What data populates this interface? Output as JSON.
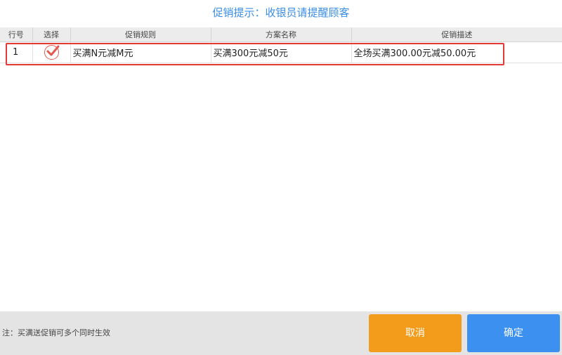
{
  "dialog": {
    "title": "促销提示：收银员请提醒顾客"
  },
  "table": {
    "columns": [
      "行号",
      "选择",
      "促销规则",
      "方案名称",
      "促销描述"
    ],
    "rows": [
      {
        "line_no": "1",
        "selected": true,
        "rule": "买满N元减M元",
        "plan_name": "买满300元减50元",
        "description": "全场买满300.00元减50.00元"
      }
    ]
  },
  "footer": {
    "note": "注：买满送促销可多个同时生效",
    "cancel_label": "取消",
    "confirm_label": "确定"
  },
  "icons": {
    "selected_check": "check-circle-icon"
  },
  "colors": {
    "title": "#3a8ee6",
    "highlight_border": "#e53935",
    "check": "#e05a4f",
    "cancel_button": "#f39c1b",
    "confirm_button": "#3c90f0",
    "footer_bg": "#e4e4e4"
  }
}
